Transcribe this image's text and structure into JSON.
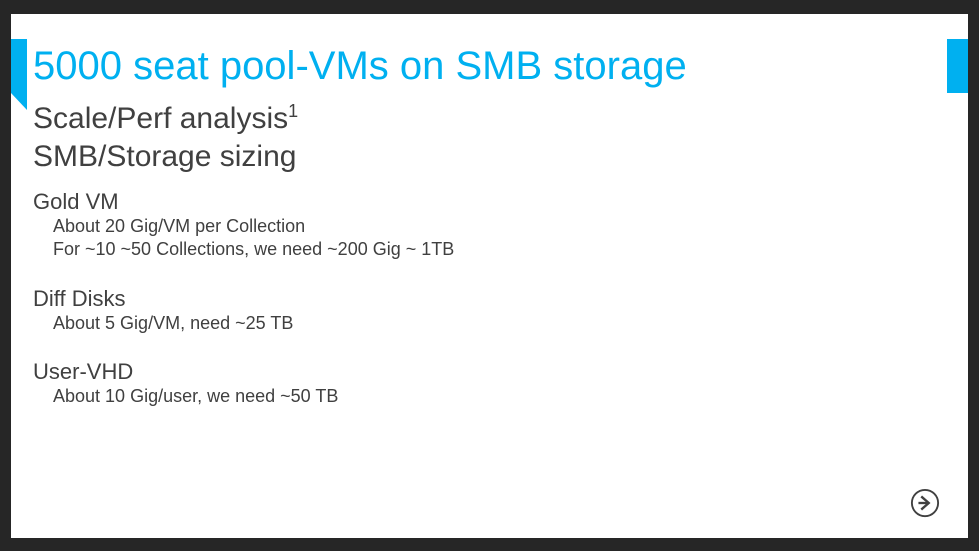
{
  "title": "5000 seat pool-VMs on SMB storage",
  "subtitle_main": "Scale/Perf analysis",
  "subtitle_sup": "1",
  "subtitle_second": "SMB/Storage sizing",
  "sections": [
    {
      "head": "Gold VM",
      "lines": [
        "About 20 Gig/VM per Collection",
        "For ~10 ~50 Collections, we need ~200 Gig ~ 1TB"
      ]
    },
    {
      "head": "Diff Disks",
      "lines": [
        "About 5 Gig/VM, need ~25 TB"
      ]
    },
    {
      "head": "User-VHD",
      "lines": [
        "About 10 Gig/user, we need ~50 TB"
      ]
    }
  ],
  "icon": "next-arrow"
}
